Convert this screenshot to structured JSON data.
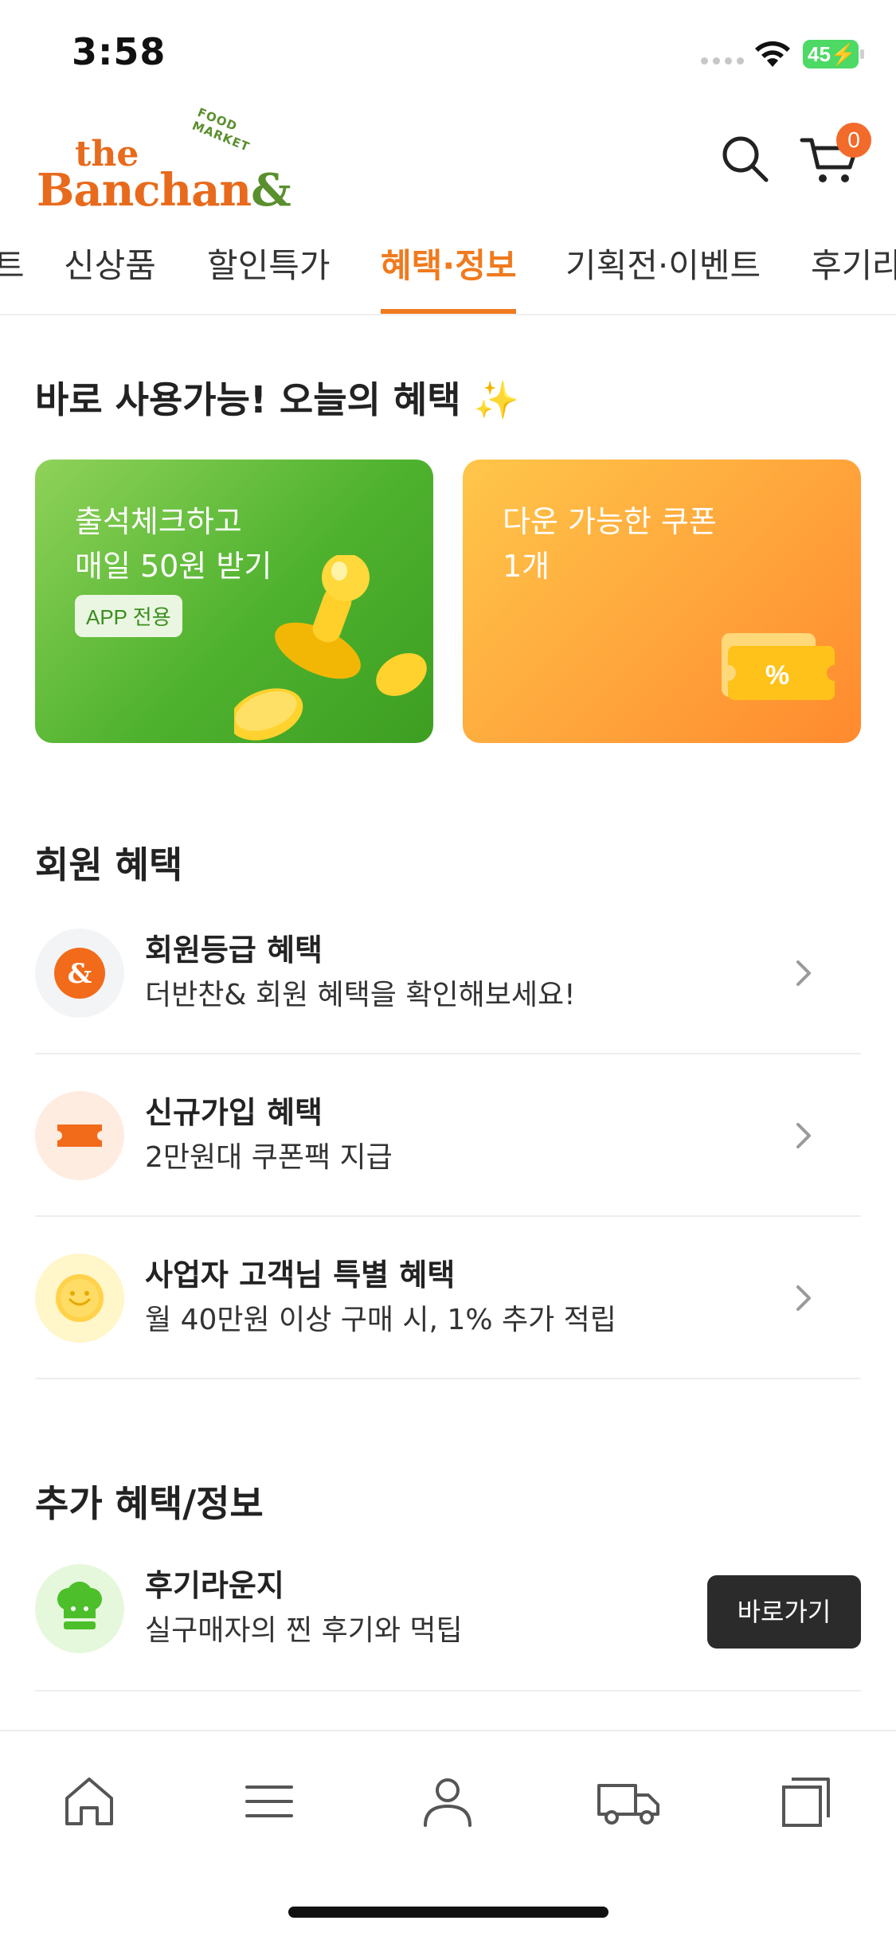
{
  "status_bar": {
    "time": "3:58",
    "battery": "45"
  },
  "header": {
    "logo": {
      "the": "the",
      "banchan": "Banchan",
      "amp": "&",
      "food_market": "FOOD MARKET"
    },
    "cart_count": "0"
  },
  "tabs": [
    {
      "label": "트"
    },
    {
      "label": "신상품"
    },
    {
      "label": "할인특가"
    },
    {
      "label": "혜택·정보"
    },
    {
      "label": "기획전·이벤트"
    },
    {
      "label": "후기라"
    }
  ],
  "active_tab": "혜택·정보",
  "today": {
    "title": "바로 사용가능! 오늘의 혜택",
    "title_emoji": "✨",
    "cards": [
      {
        "line1": "출석체크하고",
        "line2": "매일 50원 받기",
        "badge": "APP 전용",
        "color": "#5bb734"
      },
      {
        "line1": "다운 가능한 쿠폰",
        "line2": "1개",
        "color": "#ffa63c"
      }
    ]
  },
  "member": {
    "title": "회원 혜택",
    "items": [
      {
        "title": "회원등급 혜택",
        "subtitle": "더반찬& 회원 혜택을 확인해보세요!",
        "icon": "ampersand-icon"
      },
      {
        "title": "신규가입 혜택",
        "subtitle": "2만원대 쿠폰팩 지급",
        "icon": "ticket-icon"
      },
      {
        "title": "사업자 고객님 특별 혜택",
        "subtitle": "월 40만원 이상 구매 시, 1% 추가 적립",
        "icon": "coin-icon"
      }
    ]
  },
  "extra": {
    "title": "추가 혜택/정보",
    "items": [
      {
        "title": "후기라운지",
        "subtitle": "실구매자의 찐 후기와 먹팁",
        "button": "바로가기",
        "icon": "chef-hat-icon"
      }
    ]
  },
  "bottom_nav": [
    {
      "icon": "home-icon"
    },
    {
      "icon": "menu-icon"
    },
    {
      "icon": "user-icon"
    },
    {
      "icon": "delivery-truck-icon"
    },
    {
      "icon": "recent-items-icon"
    }
  ],
  "colors": {
    "accent": "#f07a1e",
    "green": "#5bb734",
    "dark_button": "#2b2b2b"
  }
}
